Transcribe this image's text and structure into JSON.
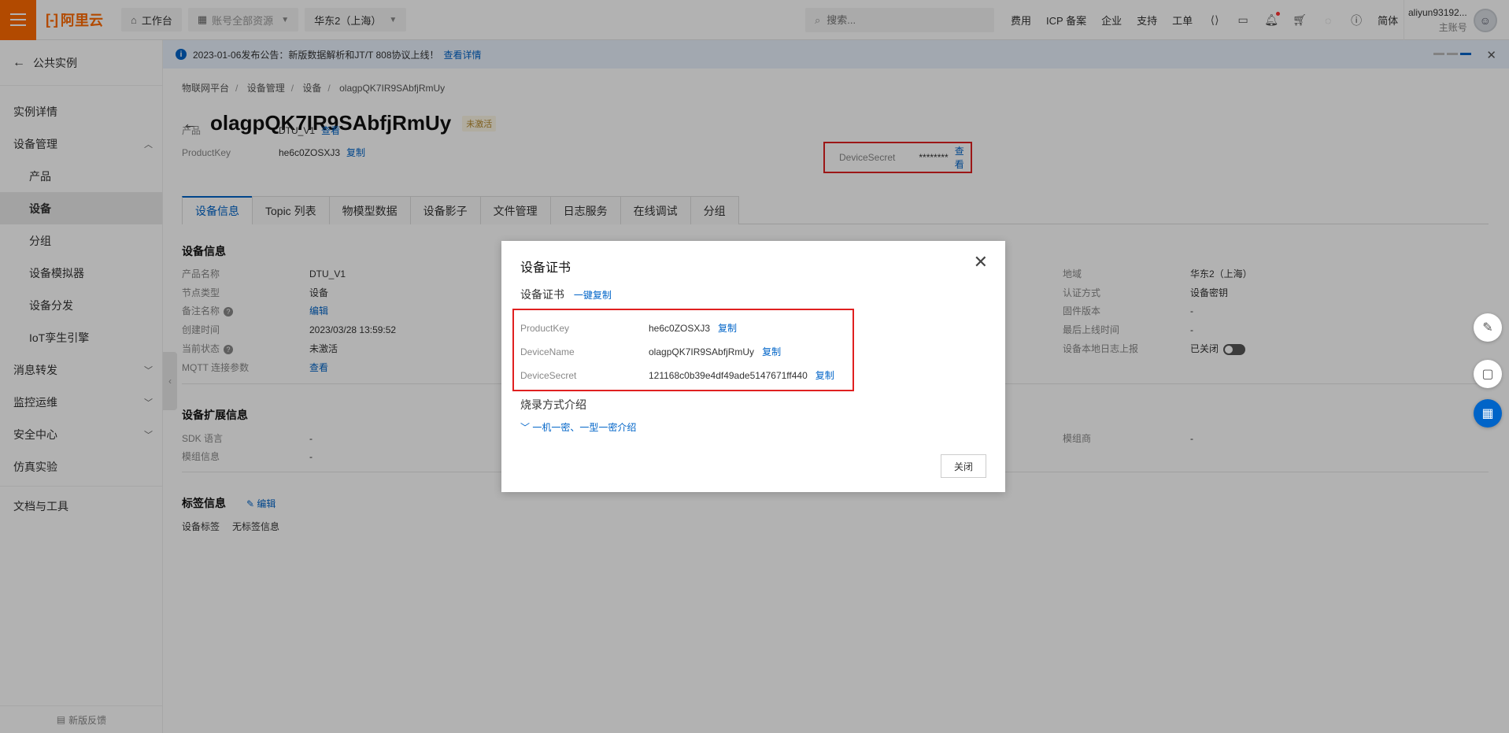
{
  "topbar": {
    "logo": "阿里云",
    "workbench": "工作台",
    "resources": "账号全部资源",
    "region": "华东2（上海）",
    "search_placeholder": "搜索...",
    "links": [
      "费用",
      "ICP 备案",
      "企业",
      "支持",
      "工单"
    ],
    "lang": "简体",
    "username": "aliyun93192...",
    "user_role": "主账号"
  },
  "notice": {
    "text": "2023-01-06发布公告：新版数据解析和JT/T 808协议上线！",
    "link": "查看详情"
  },
  "sidebar": {
    "back": "公共实例",
    "items": [
      {
        "label": "实例详情"
      },
      {
        "label": "设备管理"
      },
      {
        "label": "产品"
      },
      {
        "label": "设备"
      },
      {
        "label": "分组"
      },
      {
        "label": "设备模拟器"
      },
      {
        "label": "设备分发"
      },
      {
        "label": "IoT孪生引擎"
      },
      {
        "label": "消息转发"
      },
      {
        "label": "监控运维"
      },
      {
        "label": "安全中心"
      },
      {
        "label": "仿真实验"
      },
      {
        "label": "文档与工具"
      }
    ],
    "feedback": "新版反馈"
  },
  "breadcrumb": [
    "物联网平台",
    "设备管理",
    "设备",
    "olagpQK7IR9SAbfjRmUy"
  ],
  "device": {
    "name": "olagpQK7IR9SAbfjRmUy",
    "status": "未激活",
    "product_label": "产品",
    "product_value": "DTU_V1",
    "view": "查看",
    "productkey_label": "ProductKey",
    "productkey_value": "he6c0ZOSXJ3",
    "copy": "复制",
    "secret_label": "DeviceSecret",
    "secret_value": "********"
  },
  "tabs": [
    "设备信息",
    "Topic 列表",
    "物模型数据",
    "设备影子",
    "文件管理",
    "日志服务",
    "在线调试",
    "分组"
  ],
  "info": {
    "title": "设备信息",
    "left": [
      {
        "k": "产品名称",
        "v": "DTU_V1"
      },
      {
        "k": "节点类型",
        "v": "设备"
      },
      {
        "k": "备注名称",
        "v": "编辑"
      },
      {
        "k": "创建时间",
        "v": "2023/03/28 13:59:52"
      },
      {
        "k": "当前状态",
        "v": "未激活"
      },
      {
        "k": "MQTT 连接参数",
        "v": "查看"
      }
    ],
    "right": [
      {
        "k": "地域",
        "v": "华东2（上海）"
      },
      {
        "k": "认证方式",
        "v": "设备密钥"
      },
      {
        "k": "固件版本",
        "v": "-"
      },
      {
        "k": "最后上线时间",
        "v": "-"
      },
      {
        "k": "设备本地日志上报",
        "v": "已关闭"
      }
    ]
  },
  "ext": {
    "title": "设备扩展信息",
    "rows": [
      {
        "k": "SDK 语言",
        "v": "-"
      },
      {
        "k": "模组信息",
        "v": "-"
      }
    ],
    "right_k": "模组商",
    "right_v": "-"
  },
  "tags": {
    "title": "标签信息",
    "edit": "编辑",
    "k": "设备标签",
    "v": "无标签信息"
  },
  "modal": {
    "title": "设备证书",
    "subtitle": "设备证书",
    "copy_all": "一键复制",
    "rows": [
      {
        "k": "ProductKey",
        "v": "he6c0ZOSXJ3"
      },
      {
        "k": "DeviceName",
        "v": "olagpQK7IR9SAbfjRmUy"
      },
      {
        "k": "DeviceSecret",
        "v": "121168c0b39e4df49ade5147671ff440"
      }
    ],
    "copy": "复制",
    "burn_title": "烧录方式介绍",
    "burn_link": "一机一密、一型一密介绍",
    "close": "关闭"
  },
  "colors": {
    "accent": "#0064c8",
    "brand": "#ff6a00",
    "highlight": "#e02020"
  }
}
